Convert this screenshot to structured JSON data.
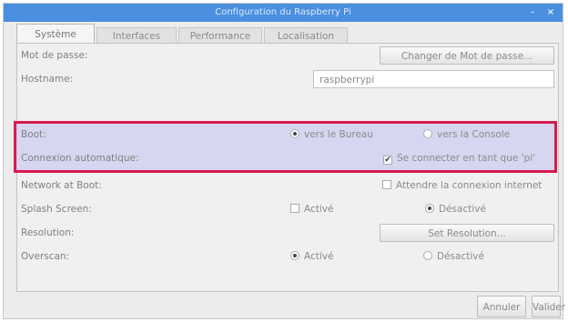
{
  "window": {
    "title": "Configuration du Raspberry Pi",
    "minimize": "–",
    "close": "×"
  },
  "tabs": [
    {
      "label": "Système"
    },
    {
      "label": "Interfaces"
    },
    {
      "label": "Performance"
    },
    {
      "label": "Localisation"
    }
  ],
  "rows": {
    "password": {
      "label": "Mot de passe:",
      "button": "Changer de Mot de passe..."
    },
    "hostname": {
      "label": "Hostname:",
      "value": "raspberrypi"
    },
    "boot": {
      "label": "Boot:",
      "option_desktop": "vers le Bureau",
      "option_console": "vers la Console",
      "selected": "desktop"
    },
    "autologin": {
      "label": "Connexion automatique:",
      "checkbox": "Se connecter en tant que 'pi'",
      "checked": true
    },
    "network_boot": {
      "label": "Network at Boot:",
      "checkbox": "Attendre la connexion internet",
      "checked": false
    },
    "splash": {
      "label": "Splash Screen:",
      "option_on": "Activé",
      "option_off": "Désactivé",
      "selected": "off"
    },
    "resolution": {
      "label": "Resolution:",
      "button": "Set Resolution..."
    },
    "overscan": {
      "label": "Overscan:",
      "option_on": "Activé",
      "option_off": "Désactivé",
      "selected": "on"
    }
  },
  "footer": {
    "cancel": "Annuler",
    "ok": "Valider"
  },
  "colors": {
    "titlebar": "#4a8fe0",
    "highlight_border": "#d81b50",
    "highlight_fill": "#cdcdf0"
  }
}
